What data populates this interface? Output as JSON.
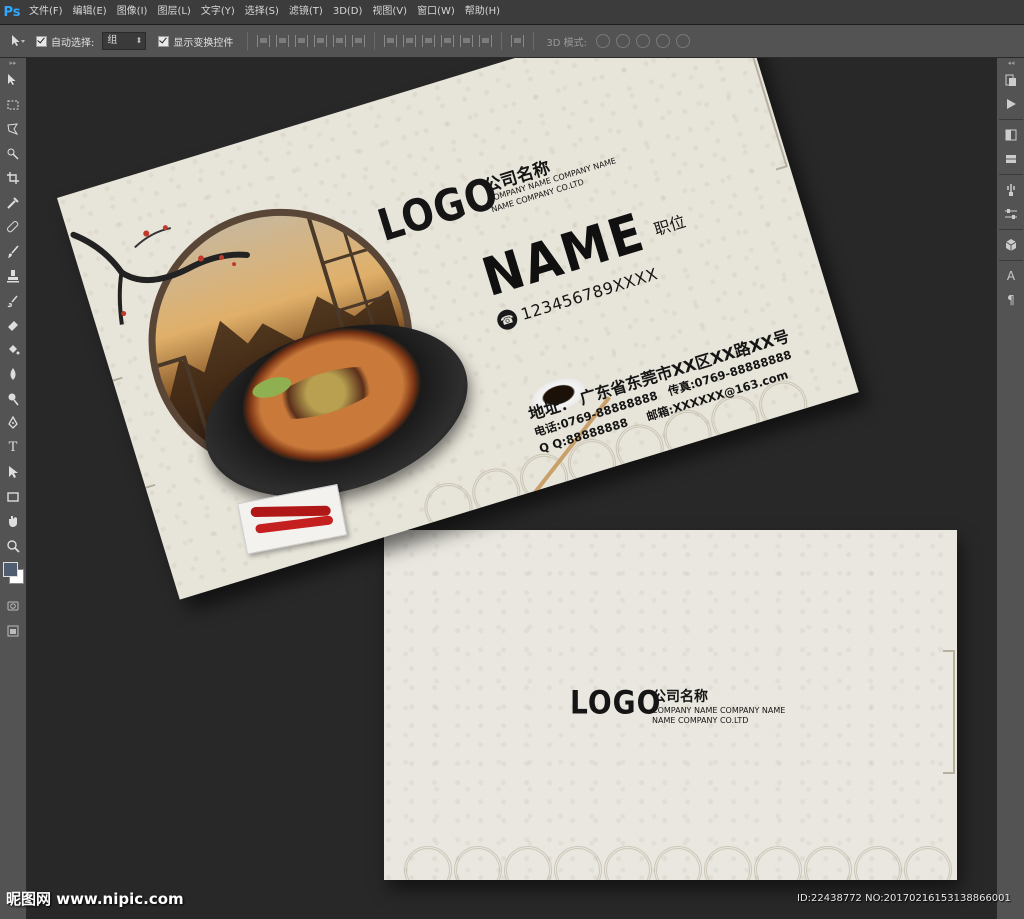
{
  "app": {
    "logo": "Ps"
  },
  "menu": [
    "文件(F)",
    "编辑(E)",
    "图像(I)",
    "图层(L)",
    "文字(Y)",
    "选择(S)",
    "滤镜(T)",
    "3D(D)",
    "视图(V)",
    "窗口(W)",
    "帮助(H)"
  ],
  "options": {
    "auto_select_label": "自动选择:",
    "auto_select_value": "组",
    "show_transform_label": "显示变换控件",
    "mode_3d_label": "3D 模式:"
  },
  "colors": {
    "foreground": "#505c70",
    "background": "#ffffff"
  },
  "card_front": {
    "logo": "LOGO",
    "company_cn": "公司名称",
    "company_en_1": "COMPANY NAME COMPANY NAME",
    "company_en_2": "NAME COMPANY CO.LTD",
    "name": "NAME",
    "title": "职位",
    "phone": "123456789XXXX",
    "address": "地址：  广东省东莞市XX区XX路XX号",
    "tel": "电话:0769-88888888",
    "fax": "传真:0769-88888888",
    "qq": "Q Q:88888888",
    "email": "邮箱:XXXXXX@163.com"
  },
  "card_back": {
    "logo": "LOGO",
    "company_cn": "公司名称",
    "company_en_1": "COMPANY NAME COMPANY NAME",
    "company_en_2": "NAME COMPANY CO.LTD"
  },
  "watermark": {
    "site": "昵图网 www.nipic.com",
    "id": "ID:22438772 NO:20170216153138866001"
  }
}
